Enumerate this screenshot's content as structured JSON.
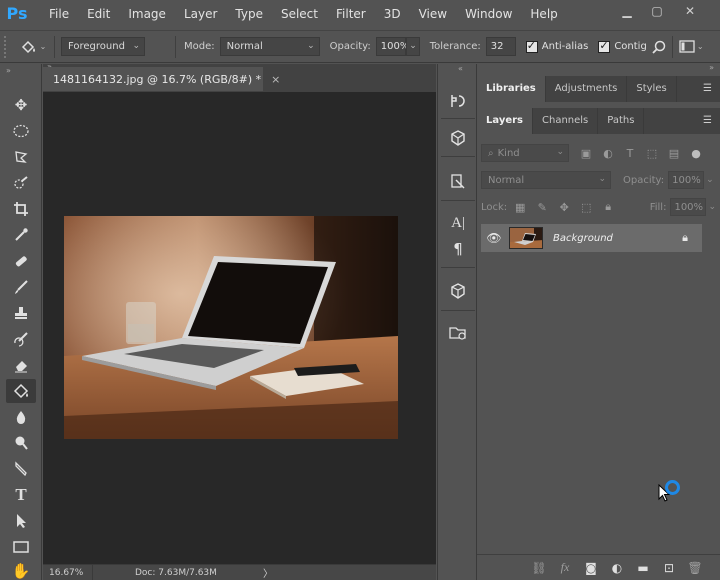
{
  "app": {
    "logo_text": "Ps",
    "accent": "#31a8ff"
  },
  "menu": [
    "File",
    "Edit",
    "Image",
    "Layer",
    "Type",
    "Select",
    "Filter",
    "3D",
    "View",
    "Window",
    "Help"
  ],
  "window_controls": {
    "minimize": "▁",
    "restore": "▢",
    "close": "✕"
  },
  "options_bar": {
    "tool_icon": "paint-bucket-icon",
    "fill_source": "Foreground",
    "mode_label": "Mode:",
    "mode_value": "Normal",
    "opacity_label": "Opacity:",
    "opacity_value": "100%",
    "tolerance_label": "Tolerance:",
    "tolerance_value": "32",
    "anti_alias_label": "Anti-alias",
    "contiguous_label": "Contig"
  },
  "tools": [
    "move-icon",
    "marquee-icon",
    "lasso-icon",
    "quick-select-icon",
    "crop-icon",
    "eyedropper-icon",
    "healing-brush-icon",
    "brush-icon",
    "clone-stamp-icon",
    "history-brush-icon",
    "eraser-icon",
    "paint-bucket-icon",
    "blur-icon",
    "dodge-icon",
    "pen-icon",
    "type-icon",
    "path-select-icon",
    "rectangle-icon",
    "hand-icon"
  ],
  "document": {
    "tab_title": "1481164132.jpg @ 16.7% (RGB/8#) *",
    "close_glyph": "×",
    "zoom": "16.67%",
    "doc_size": "Doc: 7.63M/7.63M",
    "status_arrow": "〉"
  },
  "top_panel": {
    "tabs": [
      "Libraries",
      "Adjustments",
      "Styles"
    ],
    "active": "Libraries"
  },
  "layers_panel": {
    "tabs": [
      "Layers",
      "Channels",
      "Paths"
    ],
    "active": "Layers",
    "filter_kind": "Kind",
    "blend_mode": "Normal",
    "opacity_label": "Opacity:",
    "opacity_value": "100%",
    "lock_label": "Lock:",
    "fill_label": "Fill:",
    "fill_value": "100%",
    "layers": [
      {
        "name": "Background",
        "visible": true,
        "locked": true
      }
    ]
  },
  "bottom_icons": [
    "link-icon",
    "fx-icon",
    "mask-icon",
    "adjustment-icon",
    "folder-icon",
    "new-layer-icon",
    "trash-icon"
  ]
}
